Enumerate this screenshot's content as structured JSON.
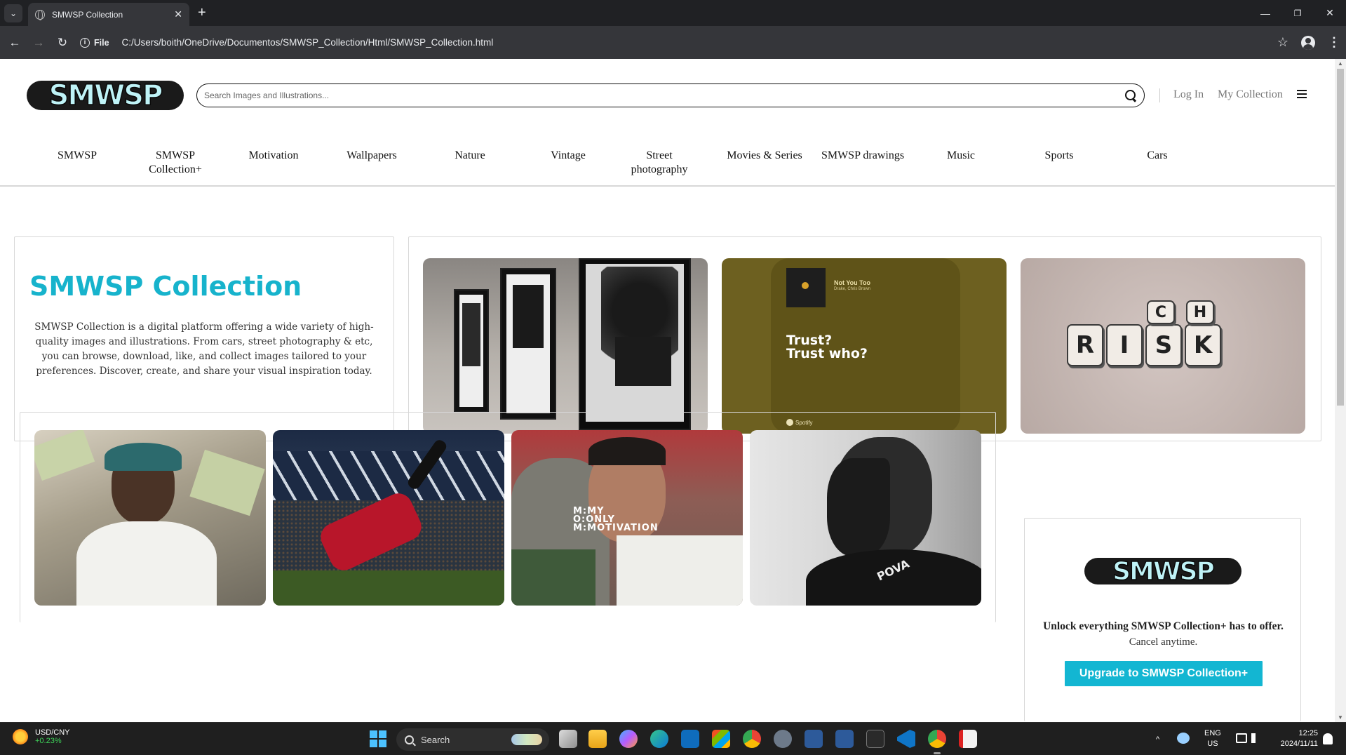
{
  "browser": {
    "tab_title": "SMWSP Collection",
    "tab_close": "✕",
    "new_tab": "+",
    "tab_list": "⌄",
    "address": "C:/Users/boith/OneDrive/Documentos/SMWSP_Collection/Html/SMWSP_Collection.html",
    "scheme_label": "File",
    "info_glyph": "i",
    "back_glyph": "←",
    "forward_glyph": "→",
    "reload_glyph": "↻",
    "star_glyph": "☆",
    "kebab_glyph": "⋮",
    "minimize_glyph": "—",
    "restore_glyph": "❐",
    "close_glyph": "✕"
  },
  "header": {
    "logo_text": "SMWSP",
    "search_placeholder": "Search Images and Illustrations...",
    "login_label": "Log In",
    "collection_label": "My Collection"
  },
  "categories": [
    "SMWSP",
    "SMWSP Collection+",
    "Motivation",
    "Wallpapers",
    "Nature",
    "Vintage",
    "Street photography",
    "Movies & Series",
    "SMWSP drawings",
    "Music",
    "Sports",
    "Cars"
  ],
  "hero": {
    "title": "SMWSP Collection",
    "description": "SMWSP Collection is a digital platform offering a wide variety of high-quality images and illustrations. From cars, street photography & etc, you can browse, download, like, and collect images tailored to your preferences. Discover, create, and share your visual inspiration today."
  },
  "gallery": {
    "spotify_song": "Not You Too",
    "spotify_artist": "Drake, Chris Brown",
    "spotify_quote_line1": "Trust?",
    "spotify_quote_line2": "Trust who?",
    "spotify_brand": "Spotify",
    "dice_letters": [
      "R",
      "I",
      "S",
      "K",
      "C",
      "H"
    ]
  },
  "motivation": {
    "overlay_line1": "M:MY",
    "overlay_line2": "O:ONLY",
    "overlay_line3": "M:MOTIVATION",
    "jersey_text": "POVA"
  },
  "promo": {
    "logo_text": "SMWSP",
    "title": "Unlock everything SMWSP Collection+ has to offer.",
    "subtitle": "Cancel anytime.",
    "button_label": "Upgrade to SMWSP Collection+"
  },
  "taskbar": {
    "widget_title": "USD/CNY",
    "widget_value": "+0.23%",
    "search_label": "Search",
    "lang_line1": "ENG",
    "lang_line2": "US",
    "time": "12:25",
    "date": "2024/11/11",
    "tray_chevron": "^"
  },
  "colors": {
    "accent": "#13b6d2",
    "hero_title": "#17b3cc",
    "chrome_dark": "#202124",
    "chrome_toolbar": "#35363a",
    "taskbar": "#1f1f1f",
    "widget_up": "#3fd55a"
  },
  "icons": [
    "search-icon",
    "menu-icon",
    "globe-icon",
    "star-icon",
    "profile-icon",
    "windows-start-icon",
    "wifi-icon",
    "volume-icon",
    "bell-icon"
  ]
}
